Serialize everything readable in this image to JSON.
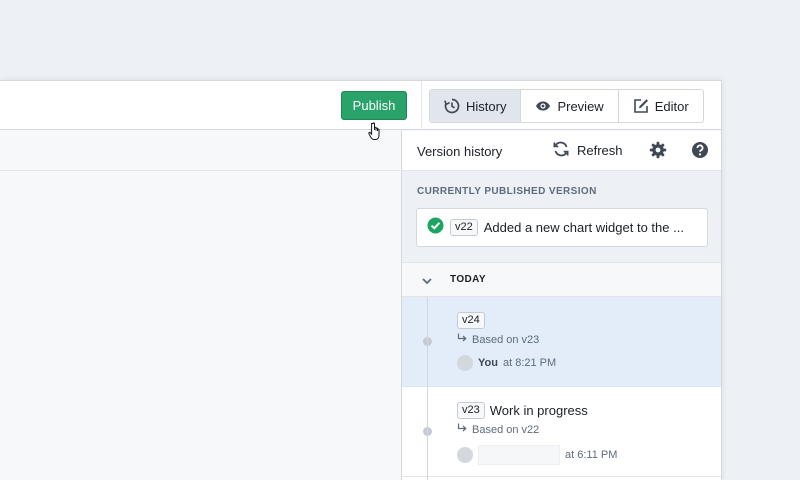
{
  "toolbar": {
    "publish_label": "Publish",
    "tabs": [
      {
        "label": "History",
        "icon": "history-icon",
        "active": true
      },
      {
        "label": "Preview",
        "icon": "eye-icon",
        "active": false
      },
      {
        "label": "Editor",
        "icon": "edit-icon",
        "active": false
      }
    ]
  },
  "panel": {
    "title": "Version history",
    "refresh_label": "Refresh",
    "published_label": "CURRENTLY PUBLISHED VERSION",
    "published": {
      "tag": "v22",
      "description": "Added a new chart widget to the ...",
      "status_icon": "check-circle-icon"
    },
    "group_label": "TODAY",
    "versions": [
      {
        "tag": "v24",
        "name": "",
        "based_on": "Based on v23",
        "author": "You",
        "time": "at 8:21 PM",
        "selected": true
      },
      {
        "tag": "v23",
        "name": "Work in progress",
        "based_on": "Based on v22",
        "author": "",
        "time": "at 6:11 PM",
        "selected": false
      }
    ]
  },
  "colors": {
    "publish_green": "#29a36a",
    "selected_row": "#e3ecf9",
    "check_green": "#1fa363",
    "background": "#edf0f4"
  }
}
